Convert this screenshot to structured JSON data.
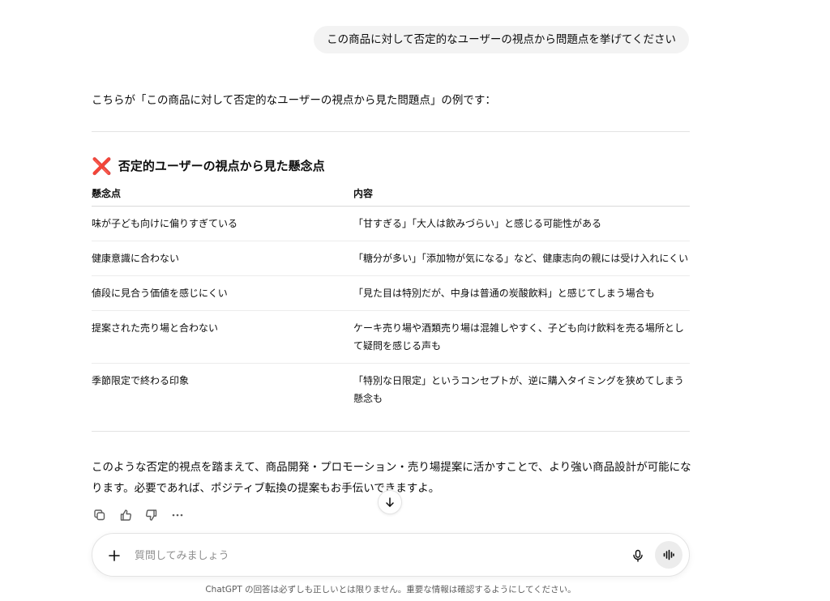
{
  "user_message": "この商品に対して否定的なユーザーの視点から問題点を挙げてください",
  "assistant": {
    "intro": "こちらが「この商品に対して否定的なユーザーの視点から見た問題点」の例です：",
    "section_icon": "❌",
    "section_heading": "否定的ユーザーの視点から見た懸念点",
    "table": {
      "headers": [
        "懸念点",
        "内容"
      ],
      "rows": [
        [
          "味が子ども向けに偏りすぎている",
          "「甘すぎる」「大人は飲みづらい」と感じる可能性がある"
        ],
        [
          "健康意識に合わない",
          "「糖分が多い」「添加物が気になる」など、健康志向の親には受け入れにくい"
        ],
        [
          "値段に見合う価値を感じにくい",
          "「見た目は特別だが、中身は普通の炭酸飲料」と感じてしまう場合も"
        ],
        [
          "提案された売り場と合わない",
          "ケーキ売り場や酒類売り場は混雑しやすく、子ども向け飲料を売る場所として疑問を感じる声も"
        ],
        [
          "季節限定で終わる印象",
          "「特別な日限定」というコンセプトが、逆に購入タイミングを狭めてしまう懸念も"
        ]
      ]
    },
    "closing": "このような否定的視点を踏まえて、商品開発・プロモーション・売り場提案に活かすことで、より強い商品設計が可能になります。必要であれば、ポジティブ転換の提案もお手伝いできますよ。"
  },
  "actions": {
    "copy": "copy-icon",
    "like": "thumbs-up-icon",
    "dislike": "thumbs-down-icon",
    "more": "more-icon"
  },
  "composer": {
    "placeholder": "質問してみましょう"
  },
  "disclaimer": "ChatGPT の回答は必ずしも正しいとは限りません。重要な情報は確認するようにしてください。",
  "colors": {
    "accent_x": "#e8536b",
    "bubble_bg": "#f3f3f3"
  }
}
